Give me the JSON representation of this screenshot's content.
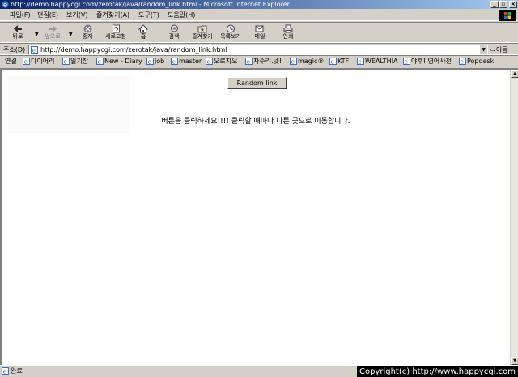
{
  "window": {
    "title": "http://demo.happycgi.com/zerotak/java/random_link.html - Microsoft Internet Explorer"
  },
  "menu": {
    "items": [
      "파일(F)",
      "편집(E)",
      "보기(V)",
      "즐겨찾기(A)",
      "도구(T)",
      "도움말(H)"
    ]
  },
  "toolbar": {
    "back": "뒤로",
    "forward": "앞으로",
    "stop": "중지",
    "refresh": "새로고침",
    "home": "홈",
    "search": "검색",
    "favorites": "즐겨찾기",
    "history": "목록보기",
    "mail": "메일",
    "print": "인쇄"
  },
  "address": {
    "label": "주소(D)",
    "url": "http://demo.happycgi.com/zerotak/java/random_link.html",
    "go": "이동"
  },
  "links": {
    "label": "연결",
    "items": [
      "다이어리",
      "일기장",
      "New - Diary",
      "job",
      "master",
      "오르지오",
      "차수리.넷!",
      "magic®",
      "KTF",
      "WEALTHIA",
      "야후! 영어사전",
      "Popdesk"
    ]
  },
  "content": {
    "button_label": "Random link",
    "message": "버튼을 클릭하세요!!!! 클릭할 때마다 다른 곳으로 이동합니다."
  },
  "status": {
    "text": "완료",
    "copyright": "Copyright(c) http://www.happycgi.com"
  }
}
